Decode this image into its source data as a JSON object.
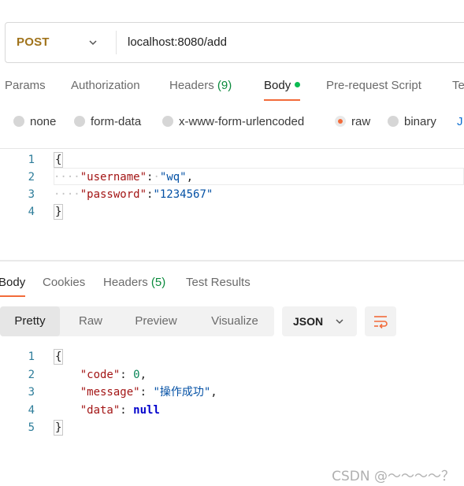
{
  "request": {
    "method": "POST",
    "url": "localhost:8080/add"
  },
  "request_tabs": [
    {
      "label": "Params",
      "count": "",
      "active": false
    },
    {
      "label": "Authorization",
      "count": "",
      "active": false
    },
    {
      "label": "Headers",
      "count": "(9)",
      "active": false
    },
    {
      "label": "Body",
      "count": "",
      "active": true
    },
    {
      "label": "Pre-request Script",
      "count": "",
      "active": false
    },
    {
      "label": "Te",
      "count": "",
      "active": false
    }
  ],
  "body_types": [
    {
      "label": "none",
      "selected": false
    },
    {
      "label": "form-data",
      "selected": false
    },
    {
      "label": "x-www-form-urlencoded",
      "selected": false
    },
    {
      "label": "raw",
      "selected": true
    },
    {
      "label": "binary",
      "selected": false
    }
  ],
  "body_types_more": "J",
  "request_body": {
    "line_numbers": [
      "1",
      "2",
      "3",
      "4"
    ],
    "open_brace": "{",
    "close_brace": "}",
    "line2_indent": "····",
    "line2_key": "\"username\"",
    "line2_sep": ":",
    "line2_value": "\"wq\"",
    "line2_comma": ",",
    "line3_indent": "····",
    "line3_key": "\"password\"",
    "line3_sep": ":",
    "line3_value": "\"1234567\""
  },
  "response_tabs": [
    {
      "label": "Body",
      "count": "",
      "active": true
    },
    {
      "label": "Cookies",
      "count": "",
      "active": false
    },
    {
      "label": "Headers",
      "count": "(5)",
      "active": false
    },
    {
      "label": "Test Results",
      "count": "",
      "active": false
    }
  ],
  "view_modes": [
    {
      "label": "Pretty",
      "active": true
    },
    {
      "label": "Raw",
      "active": false
    },
    {
      "label": "Preview",
      "active": false
    },
    {
      "label": "Visualize",
      "active": false
    }
  ],
  "format": "JSON",
  "response_body": {
    "line_numbers": [
      "1",
      "2",
      "3",
      "4",
      "5"
    ],
    "open_brace": "{",
    "close_brace": "}",
    "code_key": "\"code\"",
    "code_value": "0",
    "message_key": "\"message\"",
    "message_value": "\"操作成功\"",
    "data_key": "\"data\"",
    "data_value": "null"
  },
  "watermark": "CSDN @～～～～？",
  "colors": {
    "accent": "#f26b3a",
    "method": "#a0731b",
    "green": "#0cbb52",
    "key": "#a31515",
    "string": "#0451a5",
    "number": "#098658"
  }
}
